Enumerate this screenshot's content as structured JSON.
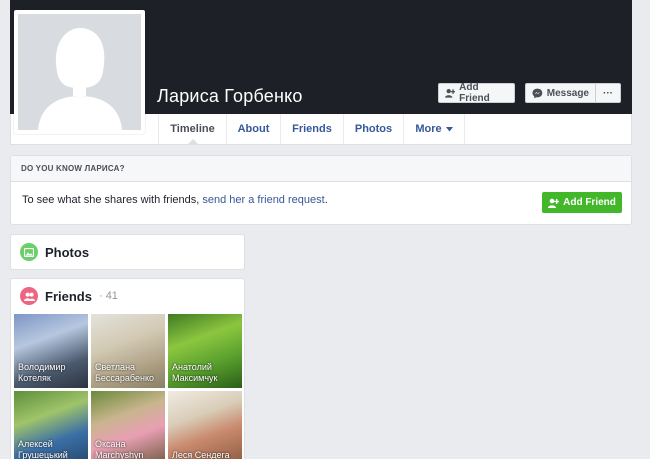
{
  "profile": {
    "name": "Лариса Горбенко"
  },
  "header_buttons": {
    "add_friend": "Add Friend",
    "message": "Message",
    "more_dots": "···"
  },
  "tabs": [
    {
      "label": "Timeline"
    },
    {
      "label": "About"
    },
    {
      "label": "Friends"
    },
    {
      "label": "Photos"
    },
    {
      "label": "More"
    }
  ],
  "know_box": {
    "heading": "DO YOU KNOW ЛАРИСА?",
    "text_before": "To see what she shares with friends, ",
    "link": "send her a friend request",
    "text_after": ".",
    "button": "Add Friend"
  },
  "photos_card": {
    "title": "Photos"
  },
  "friends_card": {
    "title": "Friends",
    "count": "· 41",
    "friends": [
      {
        "name": "Володимир Котеляк"
      },
      {
        "name": "Светлана Бессарабенко"
      },
      {
        "name": "Анатолий Максимчук"
      },
      {
        "name": "Алексей Грушецький"
      },
      {
        "name": "Оксана Marchyshyn"
      },
      {
        "name": "Леся Сендега"
      }
    ]
  },
  "colors": {
    "green": "#42b72a",
    "link": "#365899",
    "cover": "#1d2026"
  },
  "icons": [
    "add-friend-icon",
    "messenger-icon",
    "more-dots-icon",
    "caret-down-icon",
    "photos-icon",
    "friends-icon",
    "default-avatar-icon"
  ]
}
